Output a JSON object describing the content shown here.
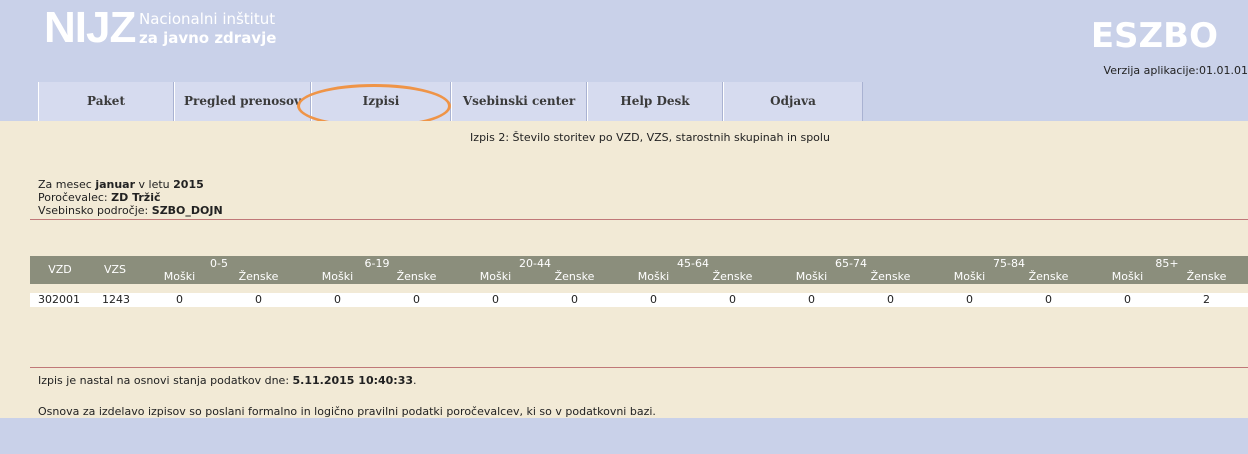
{
  "header": {
    "logo_mark": "NIJZ",
    "logo_line1": "Nacionalni inštitut",
    "logo_line2": "za javno zdravje",
    "app_title": "ESZBO",
    "version": "Verzija aplikacije:01.01.01"
  },
  "nav": {
    "tabs": [
      {
        "label": "Paket"
      },
      {
        "label": "Pregled prenosov"
      },
      {
        "label": "Izpisi"
      },
      {
        "label": "Vsebinski center"
      },
      {
        "label": "Help Desk"
      },
      {
        "label": "Odjava"
      }
    ],
    "highlight_color": "#ef9447"
  },
  "report": {
    "title": "Izpis 2: Število storitev po VZD, VZS, starostnih skupinah in spolu",
    "month_prefix": "Za mesec",
    "month": "januar",
    "year_prefix": "v letu",
    "year": "2015",
    "reporter_label": "Poročevalec:",
    "reporter": "ZD Tržič",
    "area_label": "Vsebinsko področje:",
    "area": "SZBO_DOJN"
  },
  "table": {
    "col_vzd": "VZD",
    "col_vzs": "VZS",
    "age_groups": [
      "0-5",
      "6-19",
      "20-44",
      "45-64",
      "65-74",
      "75-84",
      "85+"
    ],
    "sex_male": "Moški",
    "sex_female": "Ženske",
    "rows": [
      {
        "vzd": "302001",
        "vzs": "1243",
        "values": [
          "0",
          "0",
          "0",
          "0",
          "0",
          "0",
          "0",
          "0",
          "0",
          "0",
          "0",
          "0",
          "0",
          "2"
        ]
      }
    ],
    "header_color": "#8b8e7c"
  },
  "footer": {
    "generated_prefix": "Izpis je nastal na osnovi stanja podatkov dne:",
    "generated_at": "5.11.2015 10:40:33",
    "basis_note": "Osnova za izdelavo izpisov so poslani formalno in logično pravilni podatki poročevalcev, ki so v podatkovni bazi."
  }
}
